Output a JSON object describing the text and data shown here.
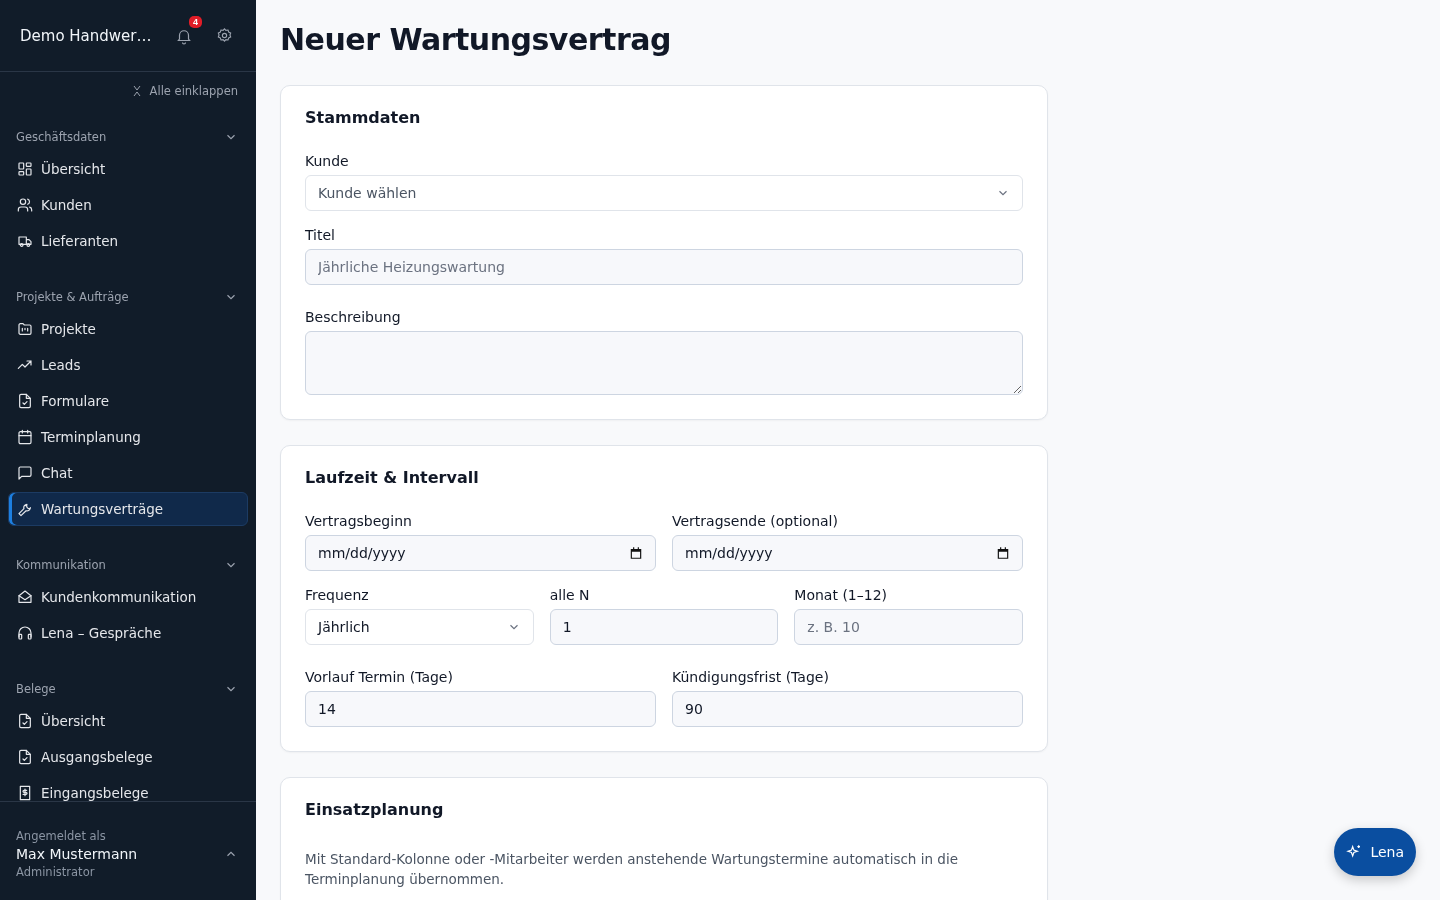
{
  "sidebar": {
    "brand": "Demo Handwer…",
    "notifications": "4",
    "collapse_all": "Alle einklappen",
    "groups": [
      {
        "title": "Geschäftsdaten",
        "expanded": true,
        "items": [
          {
            "label": "Übersicht",
            "selected": false
          },
          {
            "label": "Kunden",
            "selected": false
          },
          {
            "label": "Lieferanten",
            "selected": false
          }
        ]
      },
      {
        "title": "Projekte & Aufträge",
        "expanded": true,
        "items": [
          {
            "label": "Projekte",
            "selected": false
          },
          {
            "label": "Leads",
            "selected": false
          },
          {
            "label": "Formulare",
            "selected": false
          },
          {
            "label": "Terminplanung",
            "selected": false
          },
          {
            "label": "Chat",
            "selected": false
          },
          {
            "label": "Wartungsverträge",
            "selected": true
          }
        ]
      },
      {
        "title": "Kommunikation",
        "expanded": true,
        "items": [
          {
            "label": "Kundenkommunikation",
            "selected": false
          },
          {
            "label": "Lena – Gespräche",
            "selected": false
          }
        ]
      },
      {
        "title": "Belege",
        "expanded": true,
        "items": [
          {
            "label": "Übersicht",
            "selected": false
          },
          {
            "label": "Ausgangsbelege",
            "selected": false
          },
          {
            "label": "Eingangsbelege",
            "selected": false
          }
        ]
      }
    ],
    "user": {
      "caption": "Angemeldet als",
      "name": "Max Mustermann",
      "role": "Administrator"
    }
  },
  "page": {
    "title": "Neuer Wartungsvertrag"
  },
  "sections": [
    {
      "title": "Stammdaten",
      "rows": [
        [
          {
            "label": "Kunde",
            "kind": "select",
            "placeholder": "Kunde wählen"
          }
        ],
        [
          {
            "label": "Titel",
            "kind": "input",
            "placeholder": "Jährliche Heizungswartung"
          }
        ],
        [
          {
            "label": "Beschreibung",
            "kind": "textarea"
          }
        ]
      ]
    },
    {
      "title": "Laufzeit & Intervall",
      "rows": [
        [
          {
            "label": "Vertragsbeginn",
            "kind": "date",
            "value": "mm/dd/yyyy"
          },
          {
            "label": "Vertragsende (optional)",
            "kind": "date",
            "value": "mm/dd/yyyy"
          }
        ],
        [
          {
            "label": "Frequenz",
            "kind": "select",
            "value": "Jährlich"
          },
          {
            "label": "alle N",
            "kind": "input",
            "value": "1"
          },
          {
            "label": "Monat (1–12)",
            "kind": "input",
            "placeholder": "z. B. 10"
          }
        ],
        [
          {
            "label": "Vorlauf Termin (Tage)",
            "kind": "input",
            "value": "14"
          },
          {
            "label": "Kündigungsfrist (Tage)",
            "kind": "input",
            "value": "90"
          }
        ]
      ]
    },
    {
      "title": "Einsatzplanung",
      "text": "Mit Standard-Kolonne oder -Mitarbeiter werden anstehende Wartungstermine automatisch in die Terminplanung übernommen."
    }
  ],
  "assistant_button": "Lena"
}
